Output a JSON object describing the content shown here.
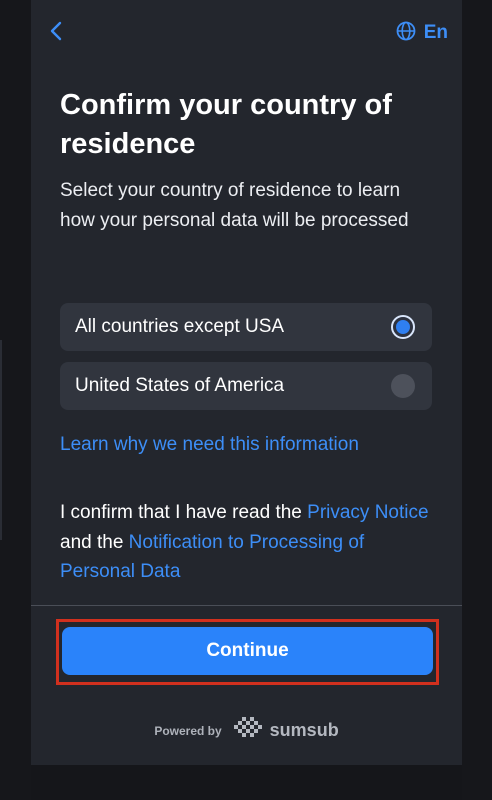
{
  "header": {
    "back_icon": "chevron-left-icon",
    "language_icon": "globe-icon",
    "language_label": "En"
  },
  "content": {
    "title": "Confirm your country of residence",
    "subtitle": "Select your country of residence to learn how your personal data will be processed",
    "options": [
      {
        "label": "All countries except USA",
        "selected": true
      },
      {
        "label": "United States of America",
        "selected": false
      }
    ],
    "learn_link": "Learn why we need this information",
    "confirm": {
      "part1": "I confirm that I have read the ",
      "link1": "Privacy Notice",
      "part2": " and the ",
      "link2": "Notification to Processing of Personal Data"
    }
  },
  "footer": {
    "continue_label": "Continue",
    "powered_by": "Powered by",
    "brand_name": "sumsub",
    "brand_icon": "sumsub-logo-icon"
  },
  "colors": {
    "accent": "#2a83fa",
    "link": "#3d8ef7",
    "panel": "#23262d",
    "option_bg": "#31353e",
    "highlight_border": "#d1301e"
  }
}
